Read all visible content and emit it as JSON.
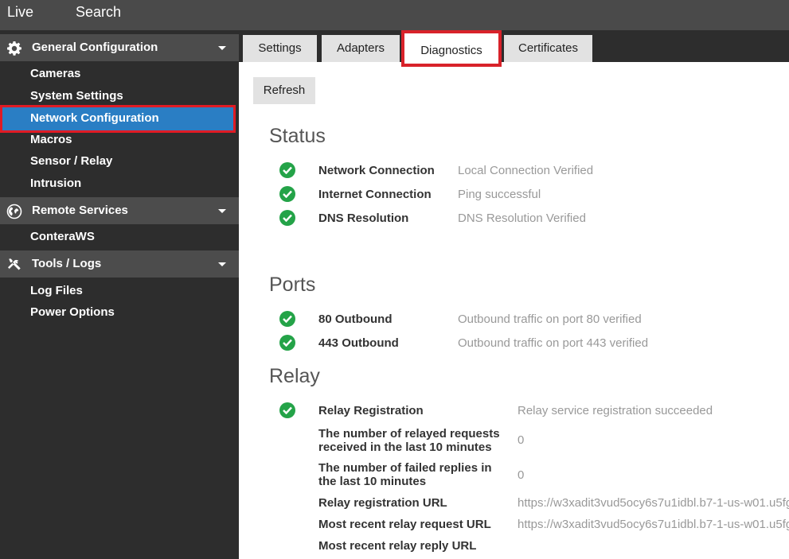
{
  "topnav": {
    "live": "Live",
    "search": "Search"
  },
  "sidebar": {
    "general": {
      "header": "General Configuration",
      "items": [
        "Cameras",
        "System Settings",
        "Network Configuration",
        "Macros",
        "Sensor / Relay",
        "Intrusion"
      ]
    },
    "remote": {
      "header": "Remote Services",
      "items": [
        "ConteraWS"
      ]
    },
    "tools": {
      "header": "Tools / Logs",
      "items": [
        "Log Files",
        "Power Options"
      ]
    },
    "active_item": "Network Configuration"
  },
  "tabs": [
    "Settings",
    "Adapters",
    "Diagnostics",
    "Certificates"
  ],
  "active_tab": "Diagnostics",
  "refresh_label": "Refresh",
  "status": {
    "title": "Status",
    "rows": [
      {
        "label": "Network Connection",
        "value": "Local Connection Verified"
      },
      {
        "label": "Internet Connection",
        "value": "Ping successful"
      },
      {
        "label": "DNS Resolution",
        "value": "DNS Resolution Verified"
      }
    ]
  },
  "ports": {
    "title": "Ports",
    "rows": [
      {
        "label": "80 Outbound",
        "value": "Outbound traffic on port 80 verified"
      },
      {
        "label": "443 Outbound",
        "value": "Outbound traffic on port 443 verified"
      }
    ]
  },
  "relay": {
    "title": "Relay",
    "rows": [
      {
        "label": "Relay Registration",
        "value": "Relay service registration succeeded"
      },
      {
        "label": "The number of relayed requests received in the last 10 minutes",
        "value": "0"
      },
      {
        "label": "The number of failed replies in the last 10 minutes",
        "value": "0"
      },
      {
        "label": "Relay registration URL",
        "value": "https://w3xadit3vud5ocy6s7u1idbl.b7-1-us-w01.u5fg"
      },
      {
        "label": "Most recent relay request URL",
        "value": "https://w3xadit3vud5ocy6s7u1idbl.b7-1-us-w01.u5fg"
      },
      {
        "label": "Most recent relay reply URL",
        "value": ""
      }
    ]
  },
  "colors": {
    "active_blue": "#2a7ec4",
    "highlight_red": "#e01b24",
    "check_green": "#24a348"
  }
}
